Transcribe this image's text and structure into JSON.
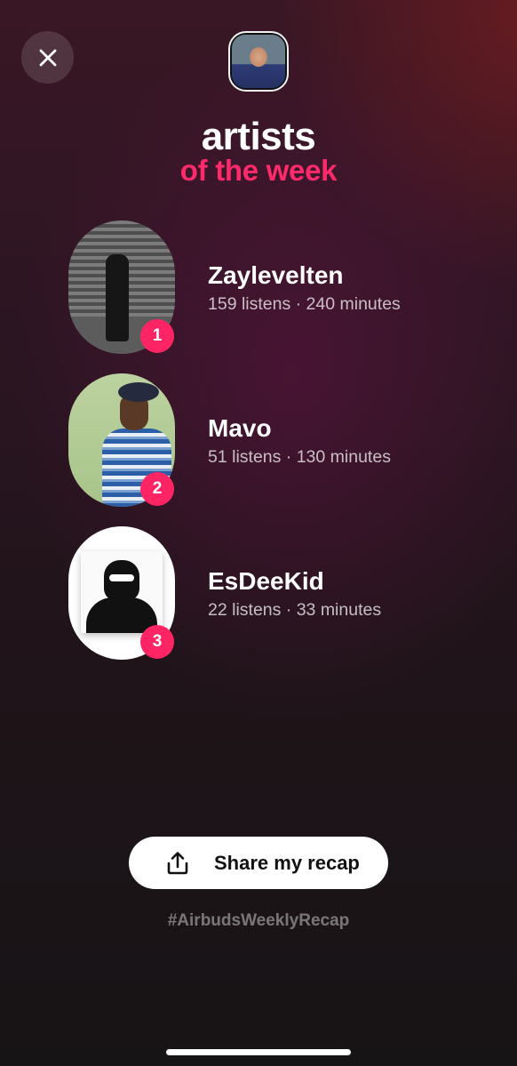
{
  "header": {
    "close_icon": "close-icon",
    "avatar_icon": "user-avatar"
  },
  "title": {
    "main": "artists",
    "sub": "of the week"
  },
  "colors": {
    "accent": "#ff2a6b",
    "badge": "#ff2564",
    "button_bg": "#ffffff"
  },
  "artists": [
    {
      "rank": "1",
      "name": "Zaylevelten",
      "stats": "159 listens · 240 minutes"
    },
    {
      "rank": "2",
      "name": "Mavo",
      "stats": "51 listens · 130 minutes"
    },
    {
      "rank": "3",
      "name": "EsDeeKid",
      "stats": "22 listens · 33 minutes"
    }
  ],
  "share": {
    "label": "Share my recap",
    "icon": "share-icon"
  },
  "hashtag": "#AirbudsWeeklyRecap"
}
